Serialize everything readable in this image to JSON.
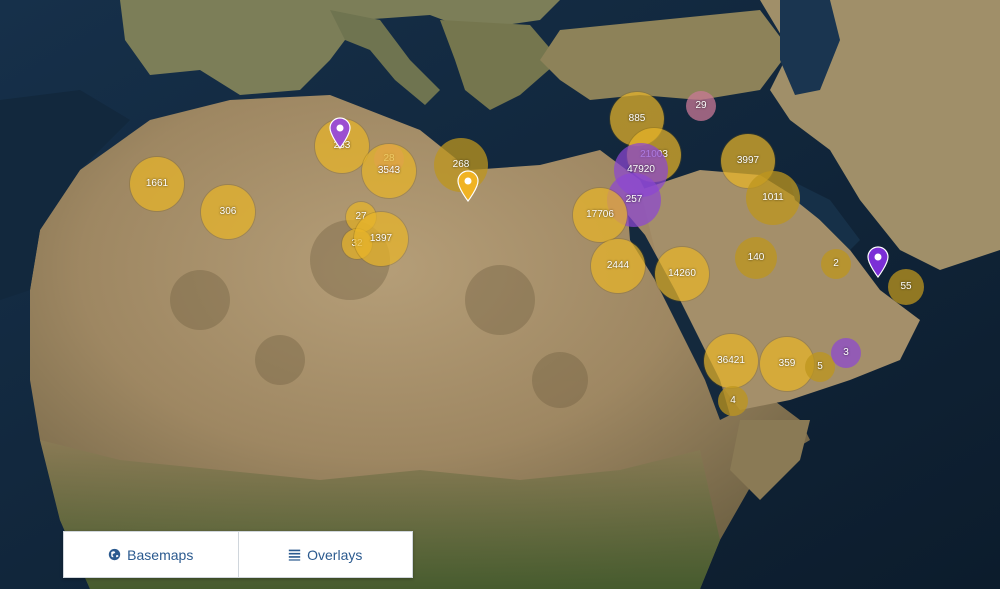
{
  "map": {
    "clusters": [
      {
        "label": "1661",
        "color": "yellow"
      },
      {
        "label": "306",
        "color": "yellow"
      },
      {
        "label": "263",
        "color": "yellow"
      },
      {
        "label": "28",
        "color": "mixed"
      },
      {
        "label": "3543",
        "color": "yellow"
      },
      {
        "label": "27",
        "color": "yellow"
      },
      {
        "label": "32",
        "color": "yellow"
      },
      {
        "label": "1397",
        "color": "yellow"
      },
      {
        "label": "268",
        "color": "olive"
      },
      {
        "label": "885",
        "color": "yellow"
      },
      {
        "label": "29",
        "color": "mixed"
      },
      {
        "label": "21003",
        "color": "yellow"
      },
      {
        "label": "47920",
        "color": "purple"
      },
      {
        "label": "257",
        "color": "purple"
      },
      {
        "label": "17706",
        "color": "yellow"
      },
      {
        "label": "2444",
        "color": "yellow"
      },
      {
        "label": "14260",
        "color": "yellow"
      },
      {
        "label": "3997",
        "color": "yellow"
      },
      {
        "label": "1011",
        "color": "olive"
      },
      {
        "label": "140",
        "color": "olive"
      },
      {
        "label": "2",
        "color": "olive"
      },
      {
        "label": "55",
        "color": "olive"
      },
      {
        "label": "36421",
        "color": "yellow"
      },
      {
        "label": "359",
        "color": "yellow"
      },
      {
        "label": "5",
        "color": "olive"
      },
      {
        "label": "3",
        "color": "purple"
      },
      {
        "label": "4",
        "color": "olive"
      }
    ],
    "markers": [
      {
        "name": "purple-map-pin",
        "color": "#9b4fd1"
      },
      {
        "name": "yellow-map-pin",
        "color": "#f0b323"
      },
      {
        "name": "violet-map-pin",
        "color": "#7b2fd6"
      }
    ]
  },
  "controls": {
    "basemaps_label": "Basemaps",
    "basemaps_icon": "globe-icon",
    "overlays_label": "Overlays",
    "overlays_icon": "list-icon",
    "accent": "#2b5a8f"
  }
}
